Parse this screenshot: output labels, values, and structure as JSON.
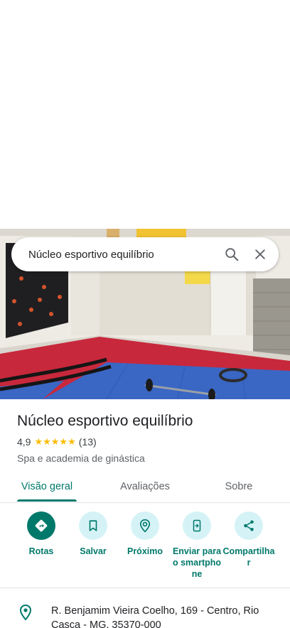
{
  "search": {
    "query": "Núcleo esportivo equilíbrio"
  },
  "place": {
    "name": "Núcleo esportivo equilíbrio",
    "rating": "4,9",
    "stars": "★★★★★",
    "review_count": "(13)",
    "category": "Spa e academia de ginástica"
  },
  "tabs": [
    {
      "label": "Visão geral",
      "active": true
    },
    {
      "label": "Avaliações",
      "active": false
    },
    {
      "label": "Sobre",
      "active": false
    }
  ],
  "actions": [
    {
      "label": "Rotas",
      "icon": "directions-icon"
    },
    {
      "label": "Salvar",
      "icon": "bookmark-icon"
    },
    {
      "label": "Próximo",
      "icon": "nearby-icon"
    },
    {
      "label": "Enviar para o smartphone",
      "icon": "send-to-phone-icon"
    },
    {
      "label": "Compartilhar",
      "icon": "share-icon"
    }
  ],
  "address": {
    "text": "R. Benjamim Vieira Coelho, 169 - Centro, Rio Casca - MG, 35370-000"
  },
  "colors": {
    "accent": "#00796b",
    "action_bg": "#d5f3f7",
    "star": "#fbbc04",
    "gym_floor_red": "#c8283c",
    "gym_floor_blue": "#3a66c4"
  }
}
